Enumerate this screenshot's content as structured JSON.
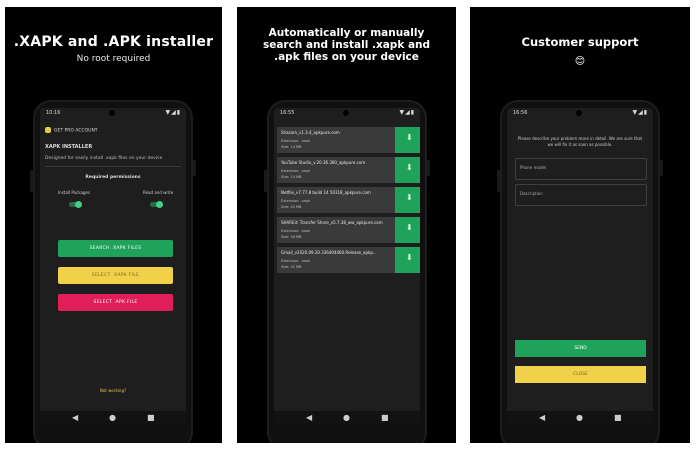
{
  "panels": [
    {
      "caption": {
        "title": ".XAPK and .APK installer",
        "subtitle": "No root required"
      },
      "status_time": "10:16",
      "pro_label": "GET PRO ACCOUNT",
      "app_title": "XAPK INSTALLER",
      "app_desc": "Designed for easily install .xapk files on your device",
      "permissions_title": "Required permissions",
      "perm_install": "Install Packages",
      "perm_read": "Read and write",
      "buttons": {
        "search": "SEARCH .XAPK FILES",
        "select_xapk": "SELECT .XAPK FILE",
        "select_apk": "SELECT .APK FILE"
      },
      "not_working": "Not working?"
    },
    {
      "caption": {
        "line1": "Automatically or manually",
        "line2": "search and install .xapk and",
        "line3": ".apk files on your device"
      },
      "status_time": "16:55",
      "files": [
        {
          "name": "Shazam_v1.3.4_apkpure.com",
          "ext": "Extension: .xapk",
          "size": "Size: 14 MB"
        },
        {
          "name": "YouTube Studio_v.20.36.360_apkpure.com",
          "ext": "Extension: .xapk",
          "size": "Size: 14 MB"
        },
        {
          "name": "Netflix_v7.77.8 build 14 50318_apkpure.com",
          "ext": "Extension: .xapk",
          "size": "Size: 42 MB"
        },
        {
          "name": "SHAREit: Transfer Share_v5.7.38_ww_apkpure.com",
          "ext": "Extension: .xapk",
          "size": "Size: 26 MB"
        },
        {
          "name": "Gmail_v2020.09.20.336404460.Release_apkp...",
          "ext": "Extension: .xapk",
          "size": "Size: 41 MB"
        }
      ]
    },
    {
      "caption": {
        "title": "Customer support",
        "emoji": "😊"
      },
      "status_time": "16:56",
      "desc": "Please describe your problem more in detail. We are sure that we will fix it as soon as possible.",
      "email_placeholder": "Phone model",
      "desc_placeholder": "Description",
      "send": "SEND",
      "close": "CLOSE"
    }
  ],
  "nav": {
    "back": "◀",
    "home": "●",
    "recent": "■"
  },
  "status_icons": "▼◢▮",
  "download_icon": "⬇"
}
